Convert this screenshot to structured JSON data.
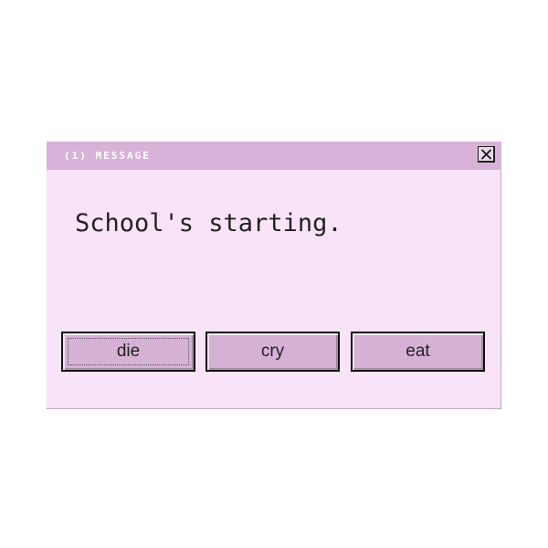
{
  "dialog": {
    "title": "(1) MESSAGE",
    "message": "School's starting.",
    "close_icon": "close-x-icon",
    "buttons": [
      {
        "label": "die",
        "focused": true
      },
      {
        "label": "cry",
        "focused": false
      },
      {
        "label": "eat",
        "focused": false
      }
    ]
  },
  "colors": {
    "titlebar": "#d8b2d8",
    "body": "#f9e3f9",
    "button_face": "#d6b1d6",
    "text": "#222222"
  }
}
